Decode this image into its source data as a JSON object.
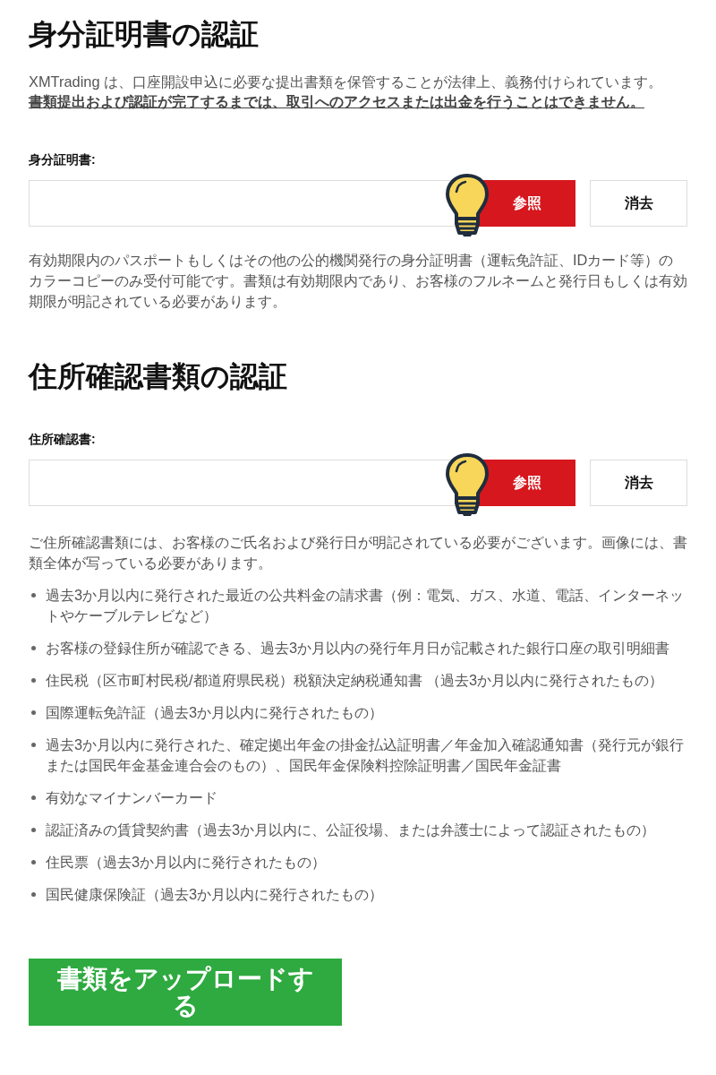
{
  "sections": [
    {
      "title": "身分証明書の認証",
      "intro": "XMTrading は、口座開設申込に必要な提出書類を保管することが法律上、義務付けられています。",
      "notice": "書類提出および認証が完了するまでは、取引へのアクセスまたは出金を行うことはできません。",
      "field_label": "身分証明書:",
      "browse_button": "参照",
      "clear_button": "消去",
      "help": "有効期限内のパスポートもしくはその他の公的機関発行の身分証明書（運転免許証、IDカード等）のカラーコピーのみ受付可能です。書類は有効期限内であり、お客様のフルネームと発行日もしくは有効期限が明記されている必要があります。"
    },
    {
      "title": "住所確認書類の認証",
      "field_label": "住所確認書:",
      "browse_button": "参照",
      "clear_button": "消去",
      "help": "ご住所確認書類には、お客様のご氏名および発行日が明記されている必要がございます。画像には、書類全体が写っている必要があります。",
      "items": [
        "過去3か月以内に発行された最近の公共料金の請求書（例：電気、ガス、水道、電話、インターネットやケーブルテレビなど）",
        "お客様の登録住所が確認できる、過去3か月以内の発行年月日が記載された銀行口座の取引明細書",
        "住民税（区市町村民税/都道府県民税）税額決定納税通知書 （過去3か月以内に発行されたもの）",
        "国際運転免許証（過去3か月以内に発行されたもの）",
        "過去3か月以内に発行された、確定拠出年金の掛金払込証明書／年金加入確認通知書（発行元が銀行または国民年金基金連合会のもの）、国民年金保険料控除証明書／国民年金証書",
        "有効なマイナンバーカード",
        "認証済みの賃貸契約書（過去3か月以内に、公証役場、または弁護士によって認証されたもの）",
        "住民票（過去3か月以内に発行されたもの）",
        "国民健康保険証（過去3か月以内に発行されたもの）"
      ]
    }
  ],
  "upload_button": "書類をアップロードする"
}
